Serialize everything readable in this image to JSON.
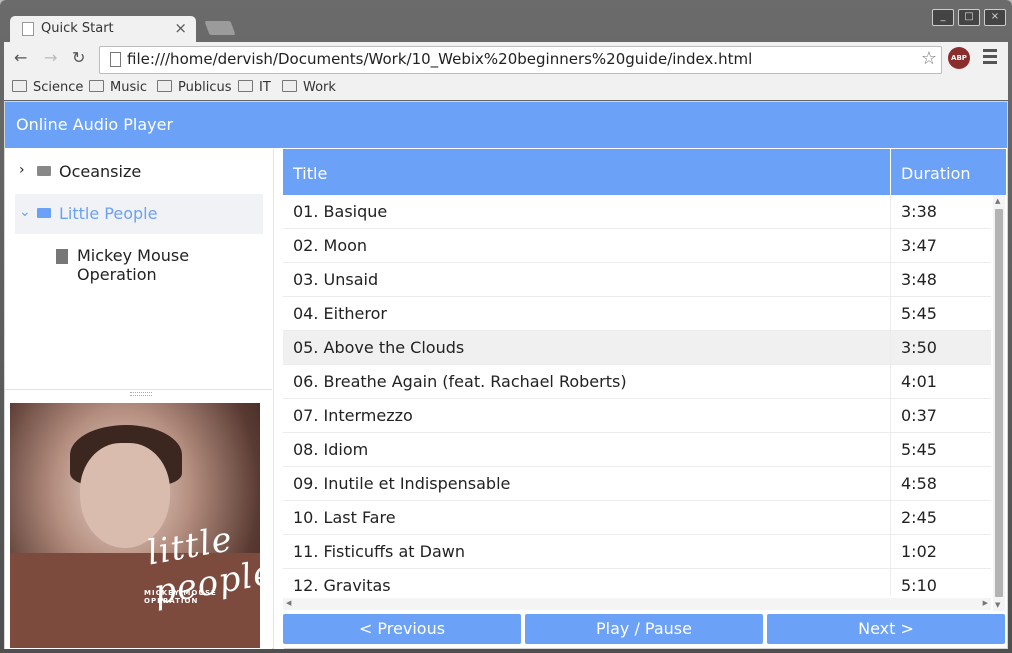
{
  "browser": {
    "tab_title": "Quick Start",
    "tab_close": "×",
    "url": "file:///home/dervish/Documents/Work/10_Webix%20beginners%20guide/index.html",
    "abp_label": "ABP",
    "back_icon": "arrow-left-icon",
    "forward_icon": "arrow-right-icon",
    "reload_icon": "reload-icon",
    "star_icon": "☆",
    "window_buttons": [
      "_",
      "□",
      "×"
    ]
  },
  "bookmarks": [
    "Science",
    "Music",
    "Publicus",
    "IT",
    "Work"
  ],
  "app": {
    "title": "Online Audio Player",
    "accent_color": "#6ba1f7"
  },
  "tree": {
    "items": [
      {
        "label": "Oceansize",
        "arrow": "›",
        "open": false
      },
      {
        "label": "Little People",
        "arrow": "⌄",
        "open": true,
        "selected": true
      },
      {
        "label": "Mickey Mouse Operation",
        "type": "file"
      }
    ]
  },
  "cover": {
    "script_text": "little people",
    "band_text": "MICKEY MOUSE OPERATION"
  },
  "grid": {
    "headers": {
      "title": "Title",
      "duration": "Duration"
    },
    "rows": [
      {
        "title": "01. Basique",
        "duration": "3:38"
      },
      {
        "title": "02. Moon",
        "duration": "3:47"
      },
      {
        "title": "03. Unsaid",
        "duration": "3:48"
      },
      {
        "title": "04. Eitheror",
        "duration": "5:45"
      },
      {
        "title": "05. Above the Clouds",
        "duration": "3:50"
      },
      {
        "title": "06. Breathe Again (feat. Rachael Roberts)",
        "duration": "4:01"
      },
      {
        "title": "07. Intermezzo",
        "duration": "0:37"
      },
      {
        "title": "08. Idiom",
        "duration": "5:45"
      },
      {
        "title": "09. Inutile et Indispensable",
        "duration": "4:58"
      },
      {
        "title": "10. Last Fare",
        "duration": "2:45"
      },
      {
        "title": "11. Fisticuffs at Dawn",
        "duration": "1:02"
      },
      {
        "title": "12. Gravitas",
        "duration": "5:10"
      }
    ]
  },
  "controls": {
    "previous": "< Previous",
    "play_pause": "Play / Pause",
    "next": "Next >"
  }
}
